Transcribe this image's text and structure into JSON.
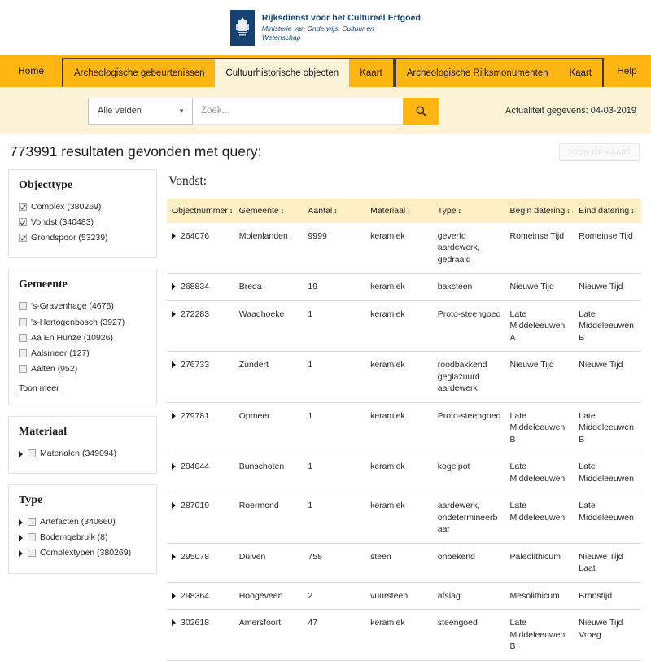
{
  "masthead": {
    "org_line1": "Rijksdienst voor het Cultureel Erfgoed",
    "org_line2": "Ministerie van Onderwijs, Cultuur en",
    "org_line3": "Wetenschap"
  },
  "nav": {
    "home": "Home",
    "group1": [
      {
        "label": "Archeologische gebeurtenissen",
        "active": false
      },
      {
        "label": "Cultuurhistorische objecten",
        "active": true
      },
      {
        "label": "Kaart",
        "active": false
      }
    ],
    "group2": [
      {
        "label": "Archeologische Rijksmonumenten",
        "active": false
      },
      {
        "label": "Kaart",
        "active": false
      }
    ],
    "help": "Help"
  },
  "search": {
    "field_selector": "Alle velden",
    "caret_icon": "chevron-down-icon",
    "input_value": "",
    "placeholder": "Zoek...",
    "button_icon": "search-icon",
    "actuality": "Actualiteit gegevens: 04-03-2019"
  },
  "results": {
    "heading": "773991 resultaten gevonden met query:",
    "map_button": "TOON OP KAART",
    "section_title": "Vondst:"
  },
  "sidebar": {
    "facets": [
      {
        "title": "Objecttype",
        "items": [
          {
            "label": "Complex (380269)",
            "checked": true,
            "expandable": false
          },
          {
            "label": "Vondst (340483)",
            "checked": true,
            "expandable": false
          },
          {
            "label": "Grondspoor (53239)",
            "checked": true,
            "expandable": false
          }
        ]
      },
      {
        "title": "Gemeente",
        "items": [
          {
            "label": "'s-Gravenhage (4675)",
            "checked": false,
            "expandable": false
          },
          {
            "label": "'s-Hertogenbosch (3927)",
            "checked": false,
            "expandable": false
          },
          {
            "label": "Aa En Hunze (10926)",
            "checked": false,
            "expandable": false
          },
          {
            "label": "Aalsmeer (127)",
            "checked": false,
            "expandable": false
          },
          {
            "label": "Aalten (952)",
            "checked": false,
            "expandable": false
          }
        ],
        "more_label": "Toon meer"
      },
      {
        "title": "Materiaal",
        "items": [
          {
            "label": "Materialen (349094)",
            "checked": false,
            "expandable": true
          }
        ]
      },
      {
        "title": "Type",
        "items": [
          {
            "label": "Artefacten (340660)",
            "checked": false,
            "expandable": true
          },
          {
            "label": "Bodemgebruik (8)",
            "checked": false,
            "expandable": true
          },
          {
            "label": "Complextypen (380269)",
            "checked": false,
            "expandable": true
          }
        ]
      }
    ]
  },
  "table": {
    "sort_icon": "sort-updown-icon",
    "expand_icon": "triangle-right-icon",
    "columns": [
      {
        "key": "objectnummer",
        "label": "Objectnummer",
        "cls": "c-objnr"
      },
      {
        "key": "gemeente",
        "label": "Gemeente",
        "cls": "c-gem"
      },
      {
        "key": "aantal",
        "label": "Aantal",
        "cls": "c-aantal"
      },
      {
        "key": "materiaal",
        "label": "Materiaal",
        "cls": "c-mat"
      },
      {
        "key": "type",
        "label": "Type",
        "cls": "c-type"
      },
      {
        "key": "begin_datering",
        "label": "Begin datering",
        "cls": "c-begin"
      },
      {
        "key": "eind_datering",
        "label": "Eind datering",
        "cls": "c-eind"
      }
    ],
    "rows": [
      {
        "objectnummer": "264076",
        "gemeente": "Molenlanden",
        "aantal": "9999",
        "materiaal": "keramiek",
        "type": "geverfd aardewerk, gedraaid",
        "begin_datering": "Romeinse Tijd",
        "eind_datering": "Romeinse Tijd"
      },
      {
        "objectnummer": "268834",
        "gemeente": "Breda",
        "aantal": "19",
        "materiaal": "keramiek",
        "type": "baksteen",
        "begin_datering": "Nieuwe Tijd",
        "eind_datering": "Nieuwe Tijd"
      },
      {
        "objectnummer": "272283",
        "gemeente": "Waadhoeke",
        "aantal": "1",
        "materiaal": "keramiek",
        "type": "Proto-steengoed",
        "begin_datering": "Late Middeleeuwen A",
        "eind_datering": "Late Middeleeuwen B"
      },
      {
        "objectnummer": "276733",
        "gemeente": "Zundert",
        "aantal": "1",
        "materiaal": "keramiek",
        "type": "roodbakkend geglazuurd aardewerk",
        "begin_datering": "Nieuwe Tijd",
        "eind_datering": "Nieuwe Tijd"
      },
      {
        "objectnummer": "279781",
        "gemeente": "Opmeer",
        "aantal": "1",
        "materiaal": "keramiek",
        "type": "Proto-steengoed",
        "begin_datering": "Late Middeleeuwen B",
        "eind_datering": "Late Middeleeuwen B"
      },
      {
        "objectnummer": "284044",
        "gemeente": "Bunschoten",
        "aantal": "1",
        "materiaal": "keramiek",
        "type": "kogelpot",
        "begin_datering": "Late Middeleeuwen",
        "eind_datering": "Late Middeleeuwen"
      },
      {
        "objectnummer": "287019",
        "gemeente": "Roermond",
        "aantal": "1",
        "materiaal": "keramiek",
        "type": "aardewerk, ondetermineerbaar",
        "begin_datering": "Late Middeleeuwen",
        "eind_datering": "Late Middeleeuwen"
      },
      {
        "objectnummer": "295078",
        "gemeente": "Duiven",
        "aantal": "758",
        "materiaal": "steen",
        "type": "onbekend",
        "begin_datering": "Paleolithicum",
        "eind_datering": "Nieuwe Tijd Laat"
      },
      {
        "objectnummer": "298364",
        "gemeente": "Hoogeveen",
        "aantal": "2",
        "materiaal": "vuursteen",
        "type": "afslag",
        "begin_datering": "Mesolithicum",
        "eind_datering": "Bronstijd"
      },
      {
        "objectnummer": "302618",
        "gemeente": "Amersfoort",
        "aantal": "47",
        "materiaal": "keramiek",
        "type": "steengoed",
        "begin_datering": "Late Middeleeuwen B",
        "eind_datering": "Nieuwe Tijd Vroeg"
      }
    ]
  },
  "colors": {
    "nav_orange": "#ffb612",
    "band_cream": "#fdf3d9",
    "table_header": "#fdeec4",
    "gov_blue": "#154273"
  }
}
